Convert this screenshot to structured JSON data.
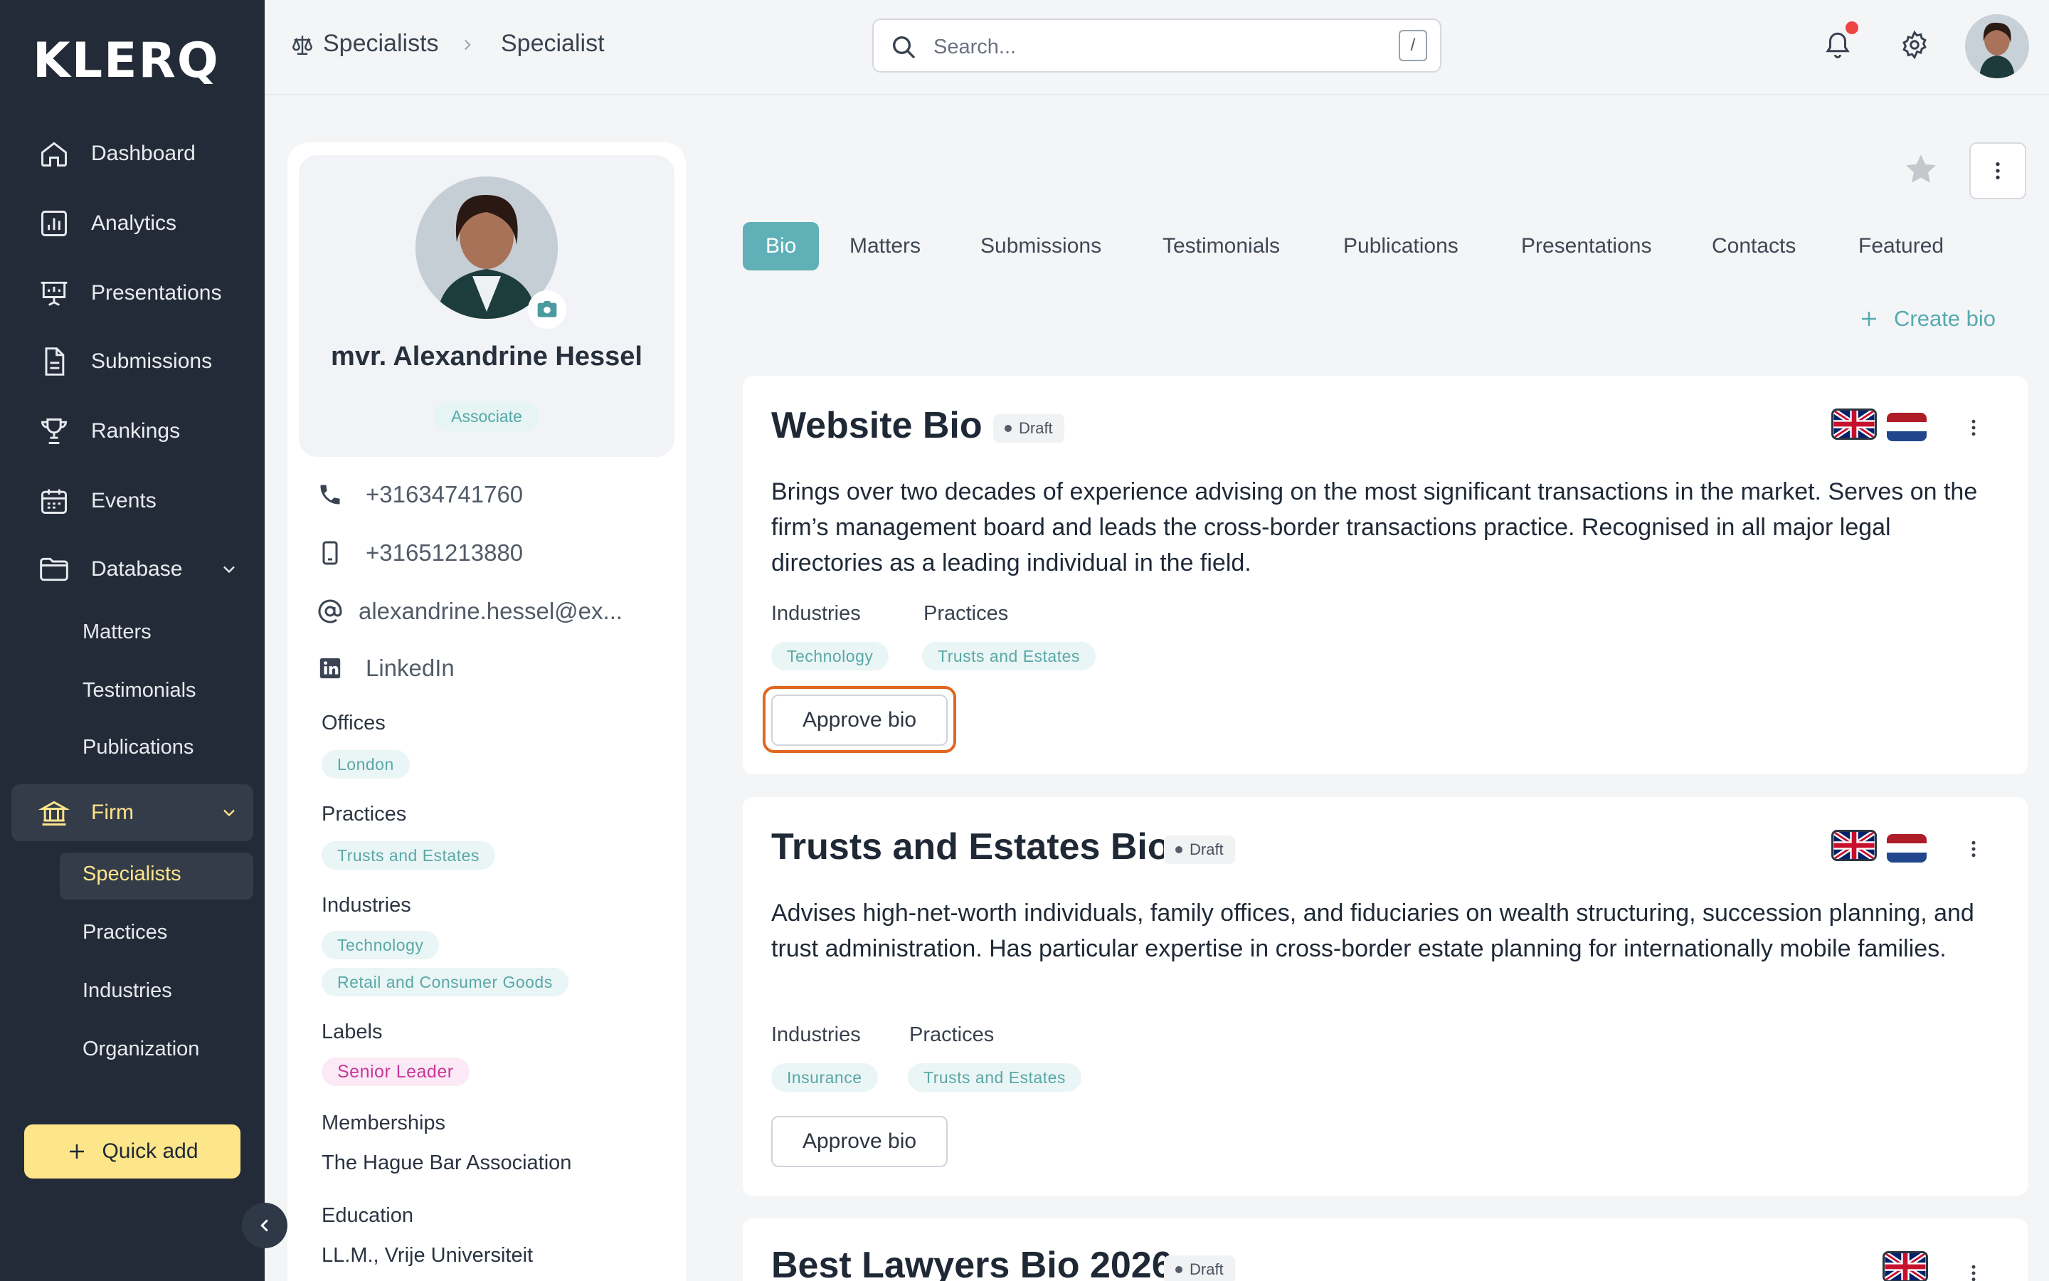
{
  "app": {
    "logo": "KLERQ"
  },
  "sidebar": {
    "items": [
      {
        "label": "Dashboard",
        "icon": "home-icon"
      },
      {
        "label": "Analytics",
        "icon": "analytics-icon"
      },
      {
        "label": "Presentations",
        "icon": "presentation-icon"
      },
      {
        "label": "Submissions",
        "icon": "document-icon"
      },
      {
        "label": "Rankings",
        "icon": "trophy-icon"
      },
      {
        "label": "Events",
        "icon": "calendar-icon"
      },
      {
        "label": "Database",
        "icon": "folder-icon"
      }
    ],
    "database_sub": [
      "Matters",
      "Testimonials",
      "Publications"
    ],
    "firm": {
      "label": "Firm",
      "icon": "bank-icon"
    },
    "firm_sub": [
      "Specialists",
      "Practices",
      "Industries",
      "Organization"
    ],
    "quick_add": "Quick add",
    "accent": "#fde58a"
  },
  "topbar": {
    "breadcrumb": [
      "Specialists",
      "Specialist"
    ],
    "search_placeholder": "Search...",
    "search_shortcut": "/"
  },
  "profile": {
    "name": "mvr. Alexandrine Hessel",
    "role": "Associate",
    "phone": "+31634741760",
    "mobile": "+31651213880",
    "email": "alexandrine.hessel@ex...",
    "linkedin": "LinkedIn",
    "offices_label": "Offices",
    "offices": [
      "London"
    ],
    "practices_label": "Practices",
    "practices": [
      "Trusts and Estates"
    ],
    "industries_label": "Industries",
    "industries": [
      "Technology",
      "Retail and Consumer Goods"
    ],
    "labels_label": "Labels",
    "labels": [
      "Senior Leader"
    ],
    "memberships_label": "Memberships",
    "membership": "The Hague Bar Association",
    "education_label": "Education",
    "education": "LL.M., Vrije Universiteit"
  },
  "tabs": [
    "Bio",
    "Matters",
    "Submissions",
    "Testimonials",
    "Publications",
    "Presentations",
    "Contacts",
    "Featured"
  ],
  "create_bio": "Create bio",
  "bios": [
    {
      "title": "Website Bio",
      "status": "Draft",
      "text": "Brings over two decades of experience advising on the most significant transactions in the market. Serves on the firm’s management board and leads the cross-border transactions practice. Recognised in all major legal directories as a leading individual in the field.",
      "industries_label": "Industries",
      "industries": [
        "Technology"
      ],
      "practices_label": "Practices",
      "practices": [
        "Trusts and Estates"
      ],
      "approve": "Approve bio"
    },
    {
      "title": "Trusts and Estates Bio",
      "status": "Draft",
      "text": "Advises high-net-worth individuals, family offices, and fiduciaries on wealth structuring, succession planning, and trust administration. Has particular expertise in cross-border estate planning for internationally mobile families.",
      "industries_label": "Industries",
      "industries": [
        "Insurance"
      ],
      "practices_label": "Practices",
      "practices": [
        "Trusts and Estates"
      ],
      "approve": "Approve bio"
    },
    {
      "title": "Best Lawyers Bio 2026",
      "status": "Draft"
    }
  ],
  "colors": {
    "teal": "#5fb0b7",
    "highlight": "#e0671f",
    "sidebar": "#242b38"
  }
}
